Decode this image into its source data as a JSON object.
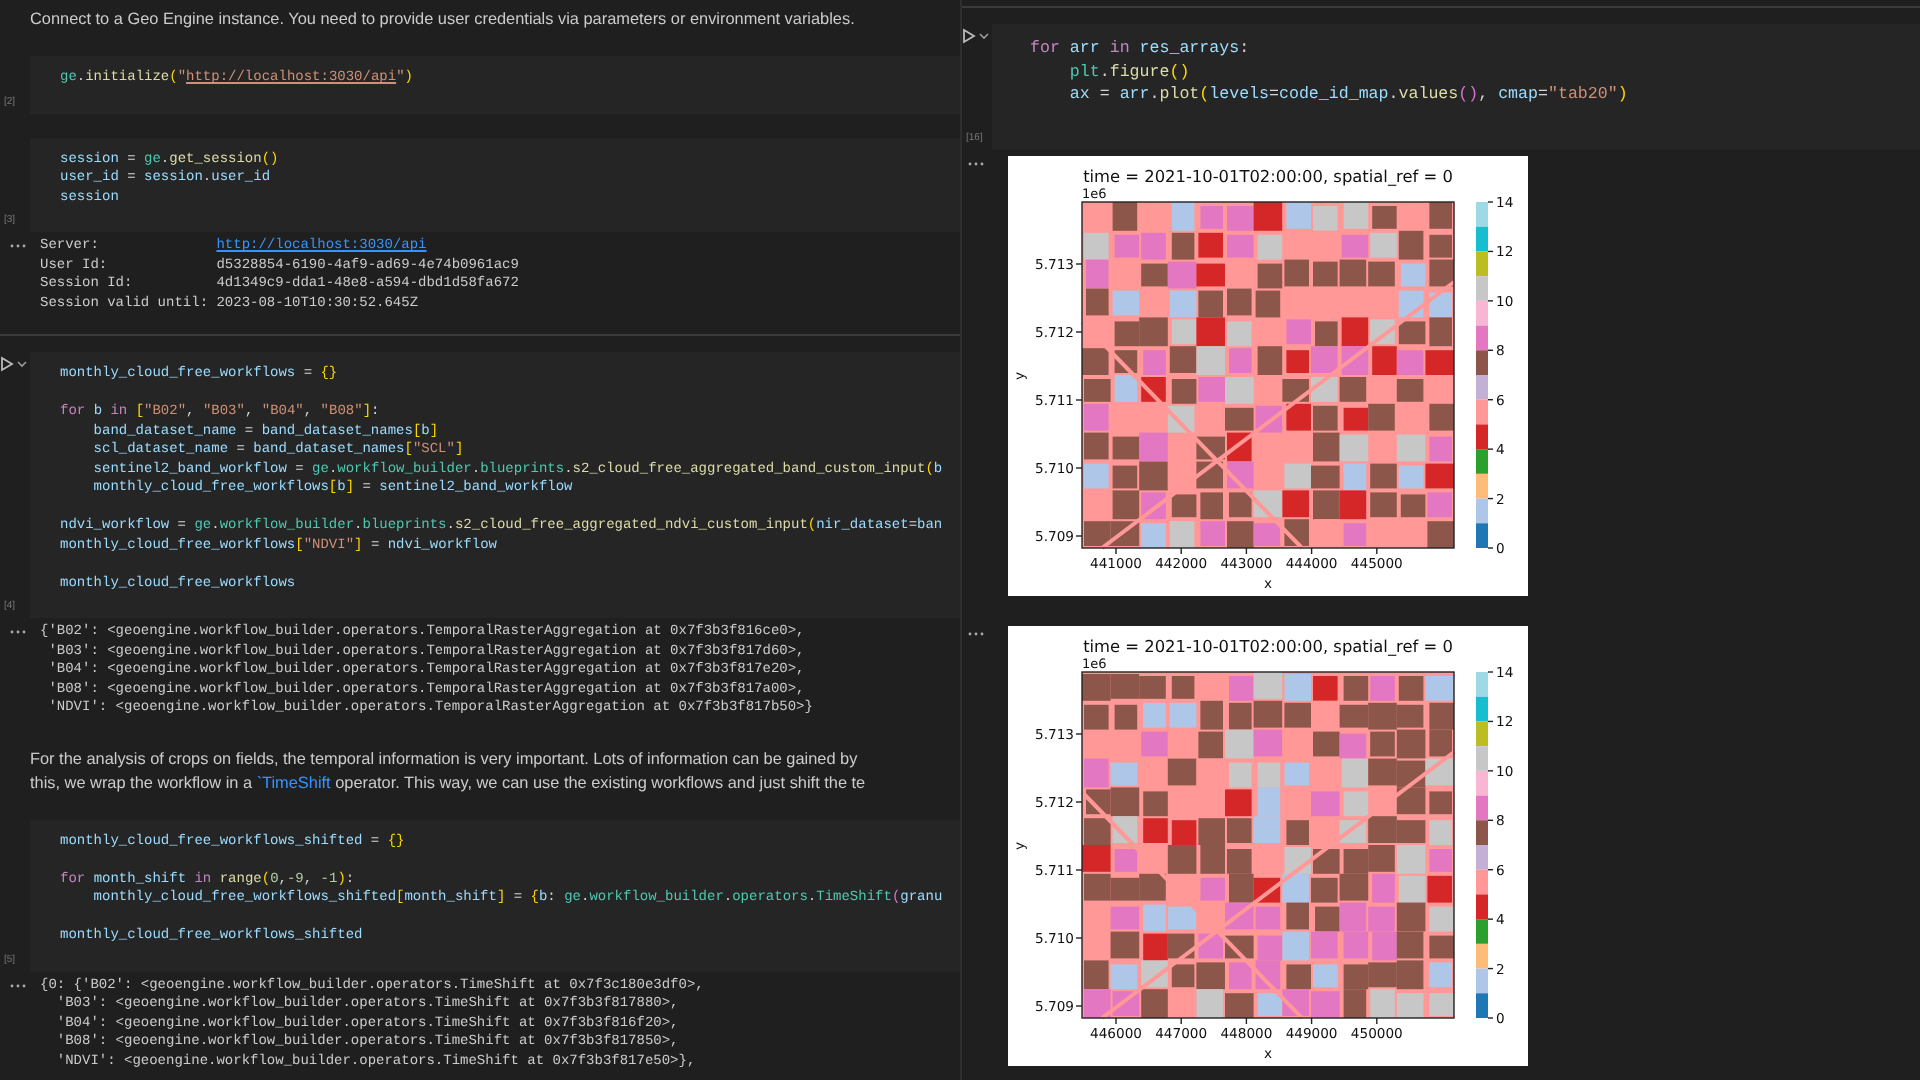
{
  "left_panel": {
    "cells": [
      {
        "kind": "markdown",
        "lines": [
          [
            {
              "kind": "text",
              "text": "Connect to a Geo Engine instance. You need to provide user credentials via parameters or environment variables."
            }
          ]
        ]
      },
      {
        "kind": "code",
        "count": "[2]",
        "focused": false,
        "blocks": [
          [
            [
              {
                "kind": "mod",
                "text": "ge"
              },
              {
                "kind": "plain",
                "text": "."
              },
              {
                "kind": "func",
                "text": "initialize"
              },
              {
                "kind": "b1",
                "text": "("
              },
              {
                "kind": "str",
                "text": "\""
              },
              {
                "kind": "link",
                "text": "http://localhost:3030/api"
              },
              {
                "kind": "str",
                "text": "\""
              },
              {
                "kind": "b1",
                "text": ")"
              }
            ]
          ]
        ]
      },
      {
        "kind": "code",
        "count": "[3]",
        "focused": false,
        "blocks": [
          [
            [
              {
                "kind": "var",
                "text": "session"
              },
              {
                "kind": "plain",
                "text": " = "
              },
              {
                "kind": "mod",
                "text": "ge"
              },
              {
                "kind": "plain",
                "text": "."
              },
              {
                "kind": "func",
                "text": "get_session"
              },
              {
                "kind": "b1",
                "text": "()"
              }
            ],
            [
              {
                "kind": "var",
                "text": "user_id"
              },
              {
                "kind": "plain",
                "text": " = "
              },
              {
                "kind": "var",
                "text": "session"
              },
              {
                "kind": "plain",
                "text": "."
              },
              {
                "kind": "var",
                "text": "user_id"
              }
            ],
            [
              {
                "kind": "var",
                "text": "session"
              }
            ]
          ]
        ]
      },
      {
        "kind": "output",
        "lines": [
          [
            {
              "kind": "plain",
              "text": "Server:              "
            },
            {
              "kind": "link",
              "text": "http://localhost:3030/api"
            }
          ],
          [
            {
              "kind": "plain",
              "text": "User Id:             d5328854-6190-4af9-ad69-4e74b0961ac9"
            }
          ],
          [
            {
              "kind": "plain",
              "text": "Session Id:          4d1349c9-dda1-48e8-a594-dbd1d58fa672"
            }
          ],
          [
            {
              "kind": "plain",
              "text": "Session valid until: 2023-08-10T10:30:52.645Z"
            }
          ]
        ]
      },
      {
        "kind": "code",
        "count": "[4]",
        "focused": true,
        "blocks": [
          [
            [
              {
                "kind": "var",
                "text": "monthly_cloud_free_workflows"
              },
              {
                "kind": "plain",
                "text": " = "
              },
              {
                "kind": "b1",
                "text": "{}"
              }
            ]
          ],
          [
            [
              {
                "kind": "kw",
                "text": "for "
              },
              {
                "kind": "var",
                "text": "b "
              },
              {
                "kind": "kw",
                "text": "in "
              },
              {
                "kind": "b1",
                "text": "["
              },
              {
                "kind": "str",
                "text": "\"B02\""
              },
              {
                "kind": "plain",
                "text": ", "
              },
              {
                "kind": "str",
                "text": "\"B03\""
              },
              {
                "kind": "plain",
                "text": ", "
              },
              {
                "kind": "str",
                "text": "\"B04\""
              },
              {
                "kind": "plain",
                "text": ", "
              },
              {
                "kind": "str",
                "text": "\"B08\""
              },
              {
                "kind": "b1",
                "text": "]"
              },
              {
                "kind": "plain",
                "text": ":"
              }
            ],
            [
              {
                "kind": "var",
                "text": "    band_dataset_name"
              },
              {
                "kind": "plain",
                "text": " = "
              },
              {
                "kind": "var",
                "text": "band_dataset_names"
              },
              {
                "kind": "b1",
                "text": "["
              },
              {
                "kind": "var",
                "text": "b"
              },
              {
                "kind": "b1",
                "text": "]"
              }
            ],
            [
              {
                "kind": "var",
                "text": "    scl_dataset_name"
              },
              {
                "kind": "plain",
                "text": " = "
              },
              {
                "kind": "var",
                "text": "band_dataset_names"
              },
              {
                "kind": "b1",
                "text": "["
              },
              {
                "kind": "str",
                "text": "\"SCL\""
              },
              {
                "kind": "b1",
                "text": "]"
              }
            ],
            [
              {
                "kind": "var",
                "text": "    sentinel2_band_workflow"
              },
              {
                "kind": "plain",
                "text": " = "
              },
              {
                "kind": "mod",
                "text": "ge"
              },
              {
                "kind": "plain",
                "text": "."
              },
              {
                "kind": "mod",
                "text": "workflow_builder"
              },
              {
                "kind": "plain",
                "text": "."
              },
              {
                "kind": "mod",
                "text": "blueprints"
              },
              {
                "kind": "plain",
                "text": "."
              },
              {
                "kind": "func",
                "text": "s2_cloud_free_aggregated_band_custom_input"
              },
              {
                "kind": "b1",
                "text": "("
              },
              {
                "kind": "var",
                "text": "b"
              }
            ],
            [
              {
                "kind": "var",
                "text": "    monthly_cloud_free_workflows"
              },
              {
                "kind": "b1",
                "text": "["
              },
              {
                "kind": "var",
                "text": "b"
              },
              {
                "kind": "b1",
                "text": "]"
              },
              {
                "kind": "plain",
                "text": " = "
              },
              {
                "kind": "var",
                "text": "sentinel2_band_workflow"
              }
            ]
          ],
          [
            [
              {
                "kind": "var",
                "text": "ndvi_workflow"
              },
              {
                "kind": "plain",
                "text": " = "
              },
              {
                "kind": "mod",
                "text": "ge"
              },
              {
                "kind": "plain",
                "text": "."
              },
              {
                "kind": "mod",
                "text": "workflow_builder"
              },
              {
                "kind": "plain",
                "text": "."
              },
              {
                "kind": "mod",
                "text": "blueprints"
              },
              {
                "kind": "plain",
                "text": "."
              },
              {
                "kind": "func",
                "text": "s2_cloud_free_aggregated_ndvi_custom_input"
              },
              {
                "kind": "b1",
                "text": "("
              },
              {
                "kind": "var",
                "text": "nir_dataset"
              },
              {
                "kind": "plain",
                "text": "="
              },
              {
                "kind": "var",
                "text": "ban"
              }
            ],
            [
              {
                "kind": "var",
                "text": "monthly_cloud_free_workflows"
              },
              {
                "kind": "b1",
                "text": "["
              },
              {
                "kind": "str",
                "text": "\"NDVI\""
              },
              {
                "kind": "b1",
                "text": "]"
              },
              {
                "kind": "plain",
                "text": " = "
              },
              {
                "kind": "var",
                "text": "ndvi_workflow"
              }
            ]
          ],
          [
            [
              {
                "kind": "var",
                "text": "monthly_cloud_free_workflows"
              }
            ]
          ]
        ]
      },
      {
        "kind": "output",
        "lines": [
          [
            {
              "kind": "plain",
              "text": "{'B02': <geoengine.workflow_builder.operators.TemporalRasterAggregation at 0x7f3b3f816ce0>,"
            }
          ],
          [
            {
              "kind": "plain",
              "text": " 'B03': <geoengine.workflow_builder.operators.TemporalRasterAggregation at 0x7f3b3f817d60>,"
            }
          ],
          [
            {
              "kind": "plain",
              "text": " 'B04': <geoengine.workflow_builder.operators.TemporalRasterAggregation at 0x7f3b3f817e20>,"
            }
          ],
          [
            {
              "kind": "plain",
              "text": " 'B08': <geoengine.workflow_builder.operators.TemporalRasterAggregation at 0x7f3b3f817a00>,"
            }
          ],
          [
            {
              "kind": "plain",
              "text": " 'NDVI': <geoengine.workflow_builder.operators.TemporalRasterAggregation at 0x7f3b3f817b50>}"
            }
          ]
        ]
      },
      {
        "kind": "markdown",
        "lines": [
          [
            {
              "kind": "text",
              "text": "For the analysis of crops on fields, the temporal information is very important. Lots of information can be gained by"
            }
          ],
          [
            {
              "kind": "text",
              "text": "this, we wrap the workflow in a "
            },
            {
              "kind": "code",
              "text": "`TimeShift"
            },
            {
              "kind": "text",
              "text": " operator. This way, we can use the existing workflows and just shift the te"
            }
          ]
        ]
      },
      {
        "kind": "code",
        "count": "[5]",
        "focused": false,
        "blocks": [
          [
            [
              {
                "kind": "var",
                "text": "monthly_cloud_free_workflows_shifted"
              },
              {
                "kind": "plain",
                "text": " = "
              },
              {
                "kind": "b1",
                "text": "{}"
              }
            ]
          ],
          [
            [
              {
                "kind": "kw",
                "text": "for "
              },
              {
                "kind": "var",
                "text": "month_shift "
              },
              {
                "kind": "kw",
                "text": "in "
              },
              {
                "kind": "func",
                "text": "range"
              },
              {
                "kind": "b1",
                "text": "("
              },
              {
                "kind": "num",
                "text": "0"
              },
              {
                "kind": "plain",
                "text": ","
              },
              {
                "kind": "num",
                "text": "-9"
              },
              {
                "kind": "plain",
                "text": ", "
              },
              {
                "kind": "num",
                "text": "-1"
              },
              {
                "kind": "b1",
                "text": ")"
              },
              {
                "kind": "plain",
                "text": ":"
              }
            ],
            [
              {
                "kind": "var",
                "text": "    monthly_cloud_free_workflows_shifted"
              },
              {
                "kind": "b1",
                "text": "["
              },
              {
                "kind": "var",
                "text": "month_shift"
              },
              {
                "kind": "b1",
                "text": "]"
              },
              {
                "kind": "plain",
                "text": " = "
              },
              {
                "kind": "b1",
                "text": "{"
              },
              {
                "kind": "var",
                "text": "b"
              },
              {
                "kind": "plain",
                "text": ": "
              },
              {
                "kind": "mod",
                "text": "ge"
              },
              {
                "kind": "plain",
                "text": "."
              },
              {
                "kind": "mod",
                "text": "workflow_builder"
              },
              {
                "kind": "plain",
                "text": "."
              },
              {
                "kind": "mod",
                "text": "operators"
              },
              {
                "kind": "plain",
                "text": "."
              },
              {
                "kind": "mod",
                "text": "TimeShift"
              },
              {
                "kind": "b2",
                "text": "("
              },
              {
                "kind": "var",
                "text": "granu"
              }
            ]
          ],
          [
            [
              {
                "kind": "var",
                "text": "monthly_cloud_free_workflows_shifted"
              }
            ]
          ]
        ]
      },
      {
        "kind": "output",
        "lines": [
          [
            {
              "kind": "plain",
              "text": "{0: {'B02': <geoengine.workflow_builder.operators.TimeShift at 0x7f3c180e3df0>,"
            }
          ],
          [
            {
              "kind": "plain",
              "text": "  'B03': <geoengine.workflow_builder.operators.TimeShift at 0x7f3b3f817880>,"
            }
          ],
          [
            {
              "kind": "plain",
              "text": "  'B04': <geoengine.workflow_builder.operators.TimeShift at 0x7f3b3f816f20>,"
            }
          ],
          [
            {
              "kind": "plain",
              "text": "  'B08': <geoengine.workflow_builder.operators.TimeShift at 0x7f3b3f817850>,"
            }
          ],
          [
            {
              "kind": "plain",
              "text": "  'NDVI': <geoengine.workflow_builder.operators.TimeShift at 0x7f3b3f817e50>},"
            }
          ]
        ]
      }
    ]
  },
  "right_panel": {
    "cells": [
      {
        "kind": "code",
        "count": "[16]",
        "focused": true,
        "blocks": [
          [
            [
              {
                "kind": "kw",
                "text": "for "
              },
              {
                "kind": "var",
                "text": "arr "
              },
              {
                "kind": "kw",
                "text": "in "
              },
              {
                "kind": "var",
                "text": "res_arrays"
              },
              {
                "kind": "plain",
                "text": ":"
              }
            ],
            [
              {
                "kind": "mod",
                "text": "    plt"
              },
              {
                "kind": "plain",
                "text": "."
              },
              {
                "kind": "func",
                "text": "figure"
              },
              {
                "kind": "b1",
                "text": "()"
              }
            ],
            [
              {
                "kind": "var",
                "text": "    ax"
              },
              {
                "kind": "plain",
                "text": " = "
              },
              {
                "kind": "var",
                "text": "arr"
              },
              {
                "kind": "plain",
                "text": "."
              },
              {
                "kind": "func",
                "text": "plot"
              },
              {
                "kind": "b1",
                "text": "("
              },
              {
                "kind": "var",
                "text": "levels"
              },
              {
                "kind": "plain",
                "text": "="
              },
              {
                "kind": "var",
                "text": "code_id_map"
              },
              {
                "kind": "plain",
                "text": "."
              },
              {
                "kind": "func",
                "text": "values"
              },
              {
                "kind": "b2",
                "text": "()"
              },
              {
                "kind": "plain",
                "text": ", "
              },
              {
                "kind": "var",
                "text": "cmap"
              },
              {
                "kind": "plain",
                "text": "="
              },
              {
                "kind": "str",
                "text": "\"tab20\""
              },
              {
                "kind": "b1",
                "text": ")"
              }
            ]
          ]
        ]
      },
      {
        "kind": "figure",
        "figure": {
          "title": "time = 2021-10-01T02:00:00, spatial_ref = 0",
          "offset_label": "1e6",
          "ylabel": "y",
          "xlabel": "x",
          "yticks": [
            "5.713",
            "5.712",
            "5.711",
            "5.710",
            "5.709"
          ],
          "xticks": [
            "441000",
            "442000",
            "443000",
            "444000",
            "445000"
          ],
          "colorbar": {
            "ticks": [
              "14",
              "12",
              "10",
              "8",
              "6",
              "4",
              "2",
              "0"
            ],
            "segments": [
              {
                "color": "#9edae5"
              },
              {
                "color": "#17becf"
              },
              {
                "color": "#bcbd22"
              },
              {
                "color": "#c7c7c7"
              },
              {
                "color": "#f7b6d2"
              },
              {
                "color": "#e377c2"
              },
              {
                "color": "#8c564b"
              },
              {
                "color": "#c5b0d5"
              },
              {
                "color": "#ff9896"
              },
              {
                "color": "#d62728"
              },
              {
                "color": "#2ca02c"
              },
              {
                "color": "#ffbb78"
              },
              {
                "color": "#aec7e8"
              },
              {
                "color": "#1f77b4"
              }
            ]
          }
        }
      },
      {
        "kind": "figure",
        "figure": {
          "title": "time = 2021-10-01T02:00:00, spatial_ref = 0",
          "offset_label": "1e6",
          "ylabel": "y",
          "xlabel": "x",
          "yticks": [
            "5.713",
            "5.712",
            "5.711",
            "5.710",
            "5.709"
          ],
          "xticks": [
            "446000",
            "447000",
            "448000",
            "449000",
            "450000"
          ],
          "colorbar": {
            "ticks": [
              "14",
              "12",
              "10",
              "8",
              "6",
              "4",
              "2",
              "0"
            ],
            "segments": [
              {
                "color": "#9edae5"
              },
              {
                "color": "#17becf"
              },
              {
                "color": "#bcbd22"
              },
              {
                "color": "#c7c7c7"
              },
              {
                "color": "#f7b6d2"
              },
              {
                "color": "#e377c2"
              },
              {
                "color": "#8c564b"
              },
              {
                "color": "#c5b0d5"
              },
              {
                "color": "#ff9896"
              },
              {
                "color": "#d62728"
              },
              {
                "color": "#2ca02c"
              },
              {
                "color": "#ffbb78"
              },
              {
                "color": "#aec7e8"
              },
              {
                "color": "#1f77b4"
              }
            ]
          }
        }
      }
    ]
  }
}
